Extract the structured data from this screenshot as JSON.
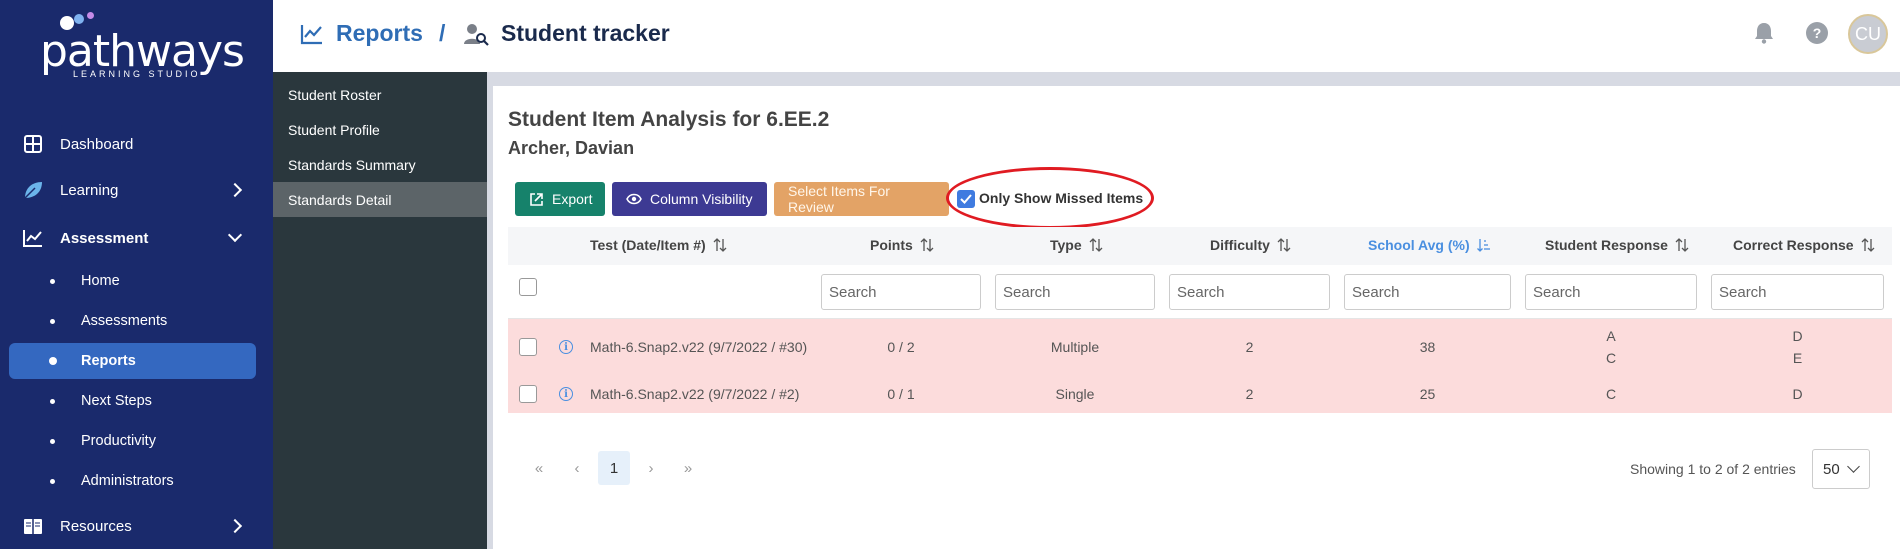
{
  "logo": {
    "name": "pathways",
    "subtitle": "LEARNING STUDIO"
  },
  "nav": {
    "dashboard": "Dashboard",
    "learning": "Learning",
    "assessment": "Assessment",
    "assessment_items": [
      "Home",
      "Assessments",
      "Reports",
      "Next Steps",
      "Productivity",
      "Administrators"
    ],
    "active_item": "Reports",
    "resources": "Resources"
  },
  "header": {
    "crumb_reports": "Reports",
    "separator": "/",
    "crumb_page": "Student tracker",
    "avatar_initials": "CU"
  },
  "subnav": {
    "items": [
      "Student Roster",
      "Student Profile",
      "Standards Summary",
      "Standards Detail"
    ],
    "active": "Standards Detail"
  },
  "report": {
    "title": "Student Item Analysis for 6.EE.2",
    "student": "Archer, Davian"
  },
  "toolbar": {
    "export": "Export",
    "column_visibility": "Column Visibility",
    "select_items": "Select Items For Review",
    "only_missed": "Only Show Missed Items",
    "only_missed_checked": true
  },
  "table": {
    "columns": [
      "Test (Date/Item #)",
      "Points",
      "Type",
      "Difficulty",
      "School Avg (%)",
      "Student Response",
      "Correct Response"
    ],
    "sorted_column": "School Avg (%)",
    "search_placeholder": "Search",
    "rows": [
      {
        "test": "Math-6.Snap2.v22 (9/7/2022 / #30)",
        "points": "0 / 2",
        "type": "Multiple",
        "difficulty": "2",
        "school_avg": "38",
        "student_response": [
          "A",
          "C"
        ],
        "correct_response": [
          "D",
          "E"
        ]
      },
      {
        "test": "Math-6.Snap2.v22 (9/7/2022 / #2)",
        "points": "0 / 1",
        "type": "Single",
        "difficulty": "2",
        "school_avg": "25",
        "student_response": [
          "C"
        ],
        "correct_response": [
          "D"
        ]
      }
    ]
  },
  "pagination": {
    "first": "«",
    "prev": "‹",
    "page": "1",
    "next": "›",
    "last": "»",
    "showing": "Showing 1 to 2 of 2 entries",
    "page_size": "50"
  },
  "colors": {
    "nav_bg": "#1a2a6c",
    "active_nav": "#3468c0",
    "export_btn": "#16826b",
    "colvis_btn": "#3d3a93",
    "select_btn": "#e3a366",
    "missed_row": "#fcdcdc",
    "highlight_ellipse": "#e01b22"
  }
}
